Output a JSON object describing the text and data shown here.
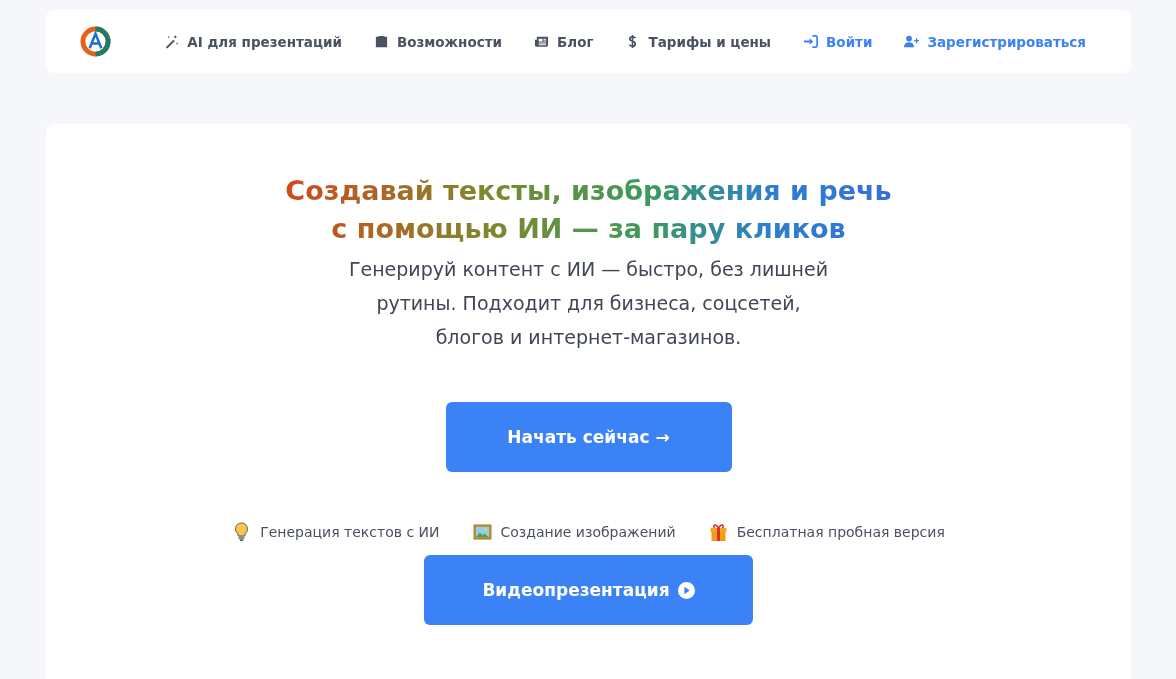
{
  "nav": {
    "items": [
      {
        "label": "AI для презентаций",
        "kind": "nav"
      },
      {
        "label": "Возможности",
        "kind": "nav"
      },
      {
        "label": "Блог",
        "kind": "nav"
      },
      {
        "label": "Тарифы и цены",
        "kind": "nav"
      },
      {
        "label": "Войти",
        "kind": "auth"
      },
      {
        "label": "Зарегистрироваться",
        "kind": "auth"
      }
    ]
  },
  "hero": {
    "title_lines": [
      "Создавай тексты, изображения и речь",
      "с помощью ИИ — за пару кликов"
    ],
    "subtitle_lines": [
      "Генерируй контент с ИИ — быстро, без лишней",
      "рутины. Подходит для бизнеса, соцсетей,",
      "блогов и интернет-магазинов."
    ],
    "cta": {
      "label": "Начать сейчас →"
    },
    "features": [
      {
        "label": "Генерация текстов с ИИ"
      },
      {
        "label": "Создание изображений"
      },
      {
        "label": "Бесплатная пробная версия"
      }
    ],
    "video_button": {
      "label": "Видеопрезентация"
    }
  }
}
